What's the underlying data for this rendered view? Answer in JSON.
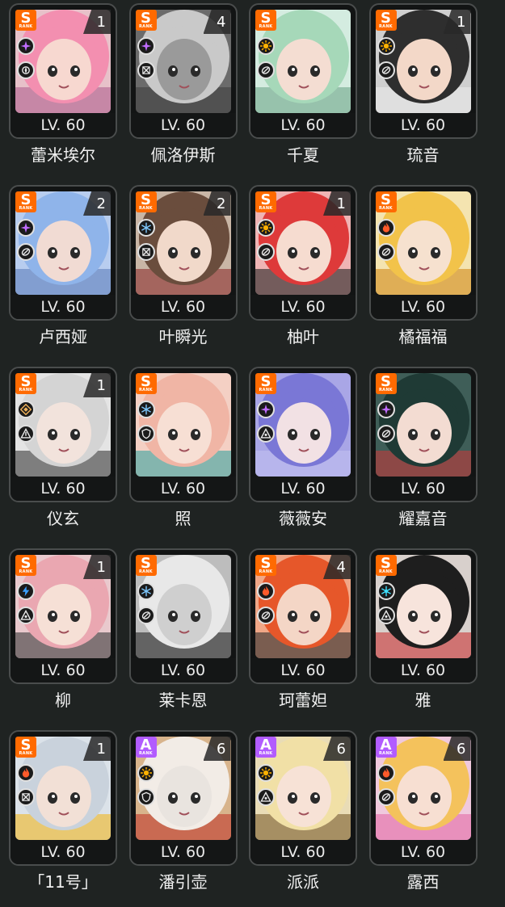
{
  "level_prefix": "LV.",
  "rank_caption": "RANK",
  "agents": [
    {
      "name": "蕾米埃尔",
      "level": "60",
      "rank": "S",
      "cinema": "1",
      "attribute": "sparkle-icon",
      "specialty": "support-icon",
      "hair": "#f38fb0",
      "skin": "#f7d8d0",
      "accent": "#b06090",
      "bg": "#e7c1c9"
    },
    {
      "name": "佩洛伊斯",
      "level": "60",
      "rank": "S",
      "cinema": "4",
      "attribute": "sparkle-icon",
      "specialty": "attack-icon",
      "hair": "#c9c9c9",
      "skin": "#9a9a9a",
      "accent": "#3f3f3f",
      "bg": "#6b6b6b"
    },
    {
      "name": "千夏",
      "level": "60",
      "rank": "S",
      "cinema": "",
      "attribute": "sun-icon",
      "specialty": "stun-icon",
      "hair": "#a6d8b9",
      "skin": "#f4ddd2",
      "accent": "#6ea789",
      "bg": "#d4ece0"
    },
    {
      "name": "琉音",
      "level": "60",
      "rank": "S",
      "cinema": "1",
      "attribute": "sun-icon",
      "specialty": "stun-icon",
      "hair": "#2e2e2e",
      "skin": "#f3d8c8",
      "accent": "#e9e9e9",
      "bg": "#cfcfcf"
    },
    {
      "name": "卢西娅",
      "level": "60",
      "rank": "S",
      "cinema": "2",
      "attribute": "sparkle-icon",
      "specialty": "stun-icon",
      "hair": "#8fb4ea",
      "skin": "#f1dbd3",
      "accent": "#5e7fba",
      "bg": "#b8cdef"
    },
    {
      "name": "叶瞬光",
      "level": "60",
      "rank": "S",
      "cinema": "2",
      "attribute": "snowflake-icon",
      "specialty": "attack-icon",
      "hair": "#6a4d3d",
      "skin": "#f1d9ca",
      "accent": "#8c2f2f",
      "bg": "#c9b6a6"
    },
    {
      "name": "柚叶",
      "level": "60",
      "rank": "S",
      "cinema": "1",
      "attribute": "sun-icon",
      "specialty": "stun-icon",
      "hair": "#de3a3a",
      "skin": "#f6dcd0",
      "accent": "#222222",
      "bg": "#efb4b4"
    },
    {
      "name": "橘福福",
      "level": "60",
      "rank": "S",
      "cinema": "",
      "attribute": "flame-icon",
      "specialty": "stun-icon",
      "hair": "#f2c34a",
      "skin": "#f6e1cf",
      "accent": "#d08b1b",
      "bg": "#f4e4b0"
    },
    {
      "name": "仪玄",
      "level": "60",
      "rank": "S",
      "cinema": "1",
      "attribute": "diamond-icon",
      "specialty": "rupture-icon",
      "hair": "#d4d4d4",
      "skin": "#f2e3dc",
      "accent": "#3a3a3a",
      "bg": "#e4e4e4"
    },
    {
      "name": "照",
      "level": "60",
      "rank": "S",
      "cinema": "",
      "attribute": "snowflake-icon",
      "specialty": "defense-icon",
      "hair": "#f0b5a5",
      "skin": "#f7dfd4",
      "accent": "#39a3a0",
      "bg": "#f4d0c4"
    },
    {
      "name": "薇薇安",
      "level": "60",
      "rank": "S",
      "cinema": "",
      "attribute": "sparkle-icon",
      "specialty": "anomaly-icon",
      "hair": "#7a77d6",
      "skin": "#f2e1e4",
      "accent": "#c1c0f0",
      "bg": "#a9a6e6"
    },
    {
      "name": "耀嘉音",
      "level": "60",
      "rank": "S",
      "cinema": "",
      "attribute": "sparkle-icon",
      "specialty": "stun-icon",
      "hair": "#1f3a35",
      "skin": "#f3dcd2",
      "accent": "#c23b3b",
      "bg": "#3f5e58"
    },
    {
      "name": "柳",
      "level": "60",
      "rank": "S",
      "cinema": "1",
      "attribute": "bolt-icon",
      "specialty": "anomaly-icon",
      "hair": "#eaa7b1",
      "skin": "#f6e0d6",
      "accent": "#3a3a3a",
      "bg": "#e9c9cd"
    },
    {
      "name": "莱卡恩",
      "level": "60",
      "rank": "S",
      "cinema": "",
      "attribute": "snowflake-icon",
      "specialty": "stun-icon",
      "hair": "#e8e8e8",
      "skin": "#cfcfcf",
      "accent": "#262626",
      "bg": "#bdbdbd"
    },
    {
      "name": "珂蕾妲",
      "level": "60",
      "rank": "S",
      "cinema": "4",
      "attribute": "flame-icon",
      "specialty": "stun-icon",
      "hair": "#e6572a",
      "skin": "#f4d6c6",
      "accent": "#2b2b2b",
      "bg": "#f0a787"
    },
    {
      "name": "雅",
      "level": "60",
      "rank": "S",
      "cinema": "",
      "attribute": "frost-icon",
      "specialty": "anomaly-icon",
      "hair": "#1e1e1e",
      "skin": "#f7e4dc",
      "accent": "#c93636",
      "bg": "#d8d0cc"
    },
    {
      "name": "「11号」",
      "level": "60",
      "rank": "S",
      "cinema": "1",
      "attribute": "flame-icon",
      "specialty": "attack-icon",
      "hair": "#c9d2dc",
      "skin": "#f2e0d6",
      "accent": "#f0b722",
      "bg": "#dbe2e9"
    },
    {
      "name": "潘引壶",
      "level": "60",
      "rank": "A",
      "cinema": "6",
      "attribute": "sun-icon",
      "specialty": "defense-icon",
      "hair": "#f2ece6",
      "skin": "#e9e4df",
      "accent": "#c0392b",
      "bg": "#d8b48c"
    },
    {
      "name": "派派",
      "level": "60",
      "rank": "A",
      "cinema": "6",
      "attribute": "sun-icon",
      "specialty": "anomaly-icon",
      "hair": "#f1e0a6",
      "skin": "#f7e2d6",
      "accent": "#7a5b2b",
      "bg": "#e9dcb6"
    },
    {
      "name": "露西",
      "level": "60",
      "rank": "A",
      "cinema": "6",
      "attribute": "flame-icon",
      "specialty": "stun-icon",
      "hair": "#f4c25c",
      "skin": "#f7dfd2",
      "accent": "#e26aa6",
      "bg": "#f0c9dd"
    }
  ]
}
